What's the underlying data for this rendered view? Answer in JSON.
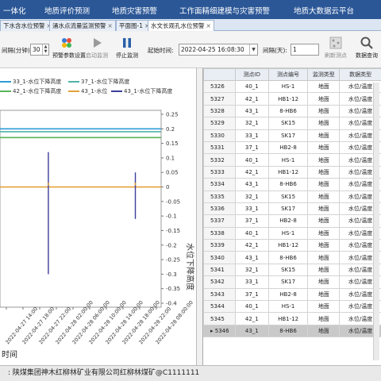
{
  "menu": [
    "一体化",
    "地质评价预测",
    "地质灾害预警",
    "工作面精细建模与灾害预警",
    "地质大数据云平台"
  ],
  "tabs": [
    "下水含水位预警",
    "涌水点流量监测预警",
    "平面图-1",
    "水文长观孔水位预警"
  ],
  "toolbar": {
    "interval_label": "间隔(分钟):",
    "interval_value": "30",
    "params_label": "预警参数设置",
    "start_label": "启动监测",
    "stop_label": "停止监测",
    "start_time_label": "起始时间:",
    "start_time_value": "2022-04-25 16:08:30",
    "days_label": "间隔(天):",
    "days_value": "1",
    "refresh_label": "刷新测点",
    "query_label": "数据查询"
  },
  "chart_data": {
    "type": "line",
    "legend": [
      "33_1-水位下降高度",
      "37_1-水位下降高度",
      "42_1-水位下降高度",
      "43_1-水位",
      "43_1-水位下降高度"
    ],
    "y2label": "水位下降高度",
    "xlabel_partial": "时间",
    "y2_ticks": [
      "0.25",
      "0.2",
      "0.15",
      "0.1",
      "0.05",
      "0",
      "-0.05",
      "-0.1",
      "-0.15",
      "-0.2",
      "-0.25",
      "-0.3",
      "-0.35",
      "-0.4"
    ],
    "x_ticks": [
      "2022-04-27 14:00",
      "2022-04-27 18:00",
      "2022-04-27 22:00",
      "2022-04-28 02:00:00",
      "2022-04-28 06:00:00",
      "2022-04-28 10:00:00",
      "2022-04-28 14:00:00",
      "2022-04-28 18:00:00",
      "2022-04-28 22:00",
      "2022-04-28 08:00:00"
    ],
    "ylim": [
      -0.4,
      0.25
    ],
    "series_levels": [
      0.2,
      0.19,
      0.17,
      0.0
    ],
    "spikes": [
      {
        "x_frac": 0.3,
        "top": 0.12,
        "bottom": -0.3
      },
      {
        "x_frac": 0.84,
        "top": 0.05,
        "bottom": -0.11
      }
    ],
    "colors": [
      "#2e9bd6",
      "#4fb3a9",
      "#5ab55a",
      "#e3a13a",
      "#3d3d9c"
    ]
  },
  "table": {
    "headers": [
      "",
      "测点ID",
      "测点编号",
      "监测类型",
      "数据类型"
    ],
    "rows": [
      [
        "5326",
        "40_1",
        "HS-1",
        "地面",
        "水位/温度"
      ],
      [
        "5327",
        "42_1",
        "HB1-12",
        "地面",
        "水位/温度"
      ],
      [
        "5328",
        "43_1",
        "8-HB6",
        "地面",
        "水位/温度"
      ],
      [
        "5329",
        "32_1",
        "SK15",
        "地面",
        "水位/温度"
      ],
      [
        "5330",
        "33_1",
        "SK17",
        "地面",
        "水位/温度"
      ],
      [
        "5331",
        "37_1",
        "HB2-8",
        "地面",
        "水位/温度"
      ],
      [
        "5332",
        "40_1",
        "HS-1",
        "地面",
        "水位/温度"
      ],
      [
        "5333",
        "42_1",
        "HB1-12",
        "地面",
        "水位/温度"
      ],
      [
        "5334",
        "43_1",
        "8-HB6",
        "地面",
        "水位/温度"
      ],
      [
        "5335",
        "32_1",
        "SK15",
        "地面",
        "水位/温度"
      ],
      [
        "5336",
        "33_1",
        "SK17",
        "地面",
        "水位/温度"
      ],
      [
        "5337",
        "37_1",
        "HB2-8",
        "地面",
        "水位/温度"
      ],
      [
        "5338",
        "40_1",
        "HS-1",
        "地面",
        "水位/温度"
      ],
      [
        "5339",
        "42_1",
        "HB1-12",
        "地面",
        "水位/温度"
      ],
      [
        "5340",
        "43_1",
        "8-HB6",
        "地面",
        "水位/温度"
      ],
      [
        "5341",
        "32_1",
        "SK15",
        "地面",
        "水位/温度"
      ],
      [
        "5342",
        "33_1",
        "SK17",
        "地面",
        "水位/温度"
      ],
      [
        "5343",
        "37_1",
        "HB2-8",
        "地面",
        "水位/温度"
      ],
      [
        "5344",
        "40_1",
        "HS-1",
        "地面",
        "水位/温度"
      ],
      [
        "5345",
        "42_1",
        "HB1-12",
        "地面",
        "水位/温度"
      ],
      [
        "5346",
        "43_1",
        "8-HB6",
        "地面",
        "水位/温度"
      ]
    ],
    "selected_index": 20
  },
  "status": "陕煤集团神木红柳林矿业有限公司红柳林煤矿@C1111111"
}
